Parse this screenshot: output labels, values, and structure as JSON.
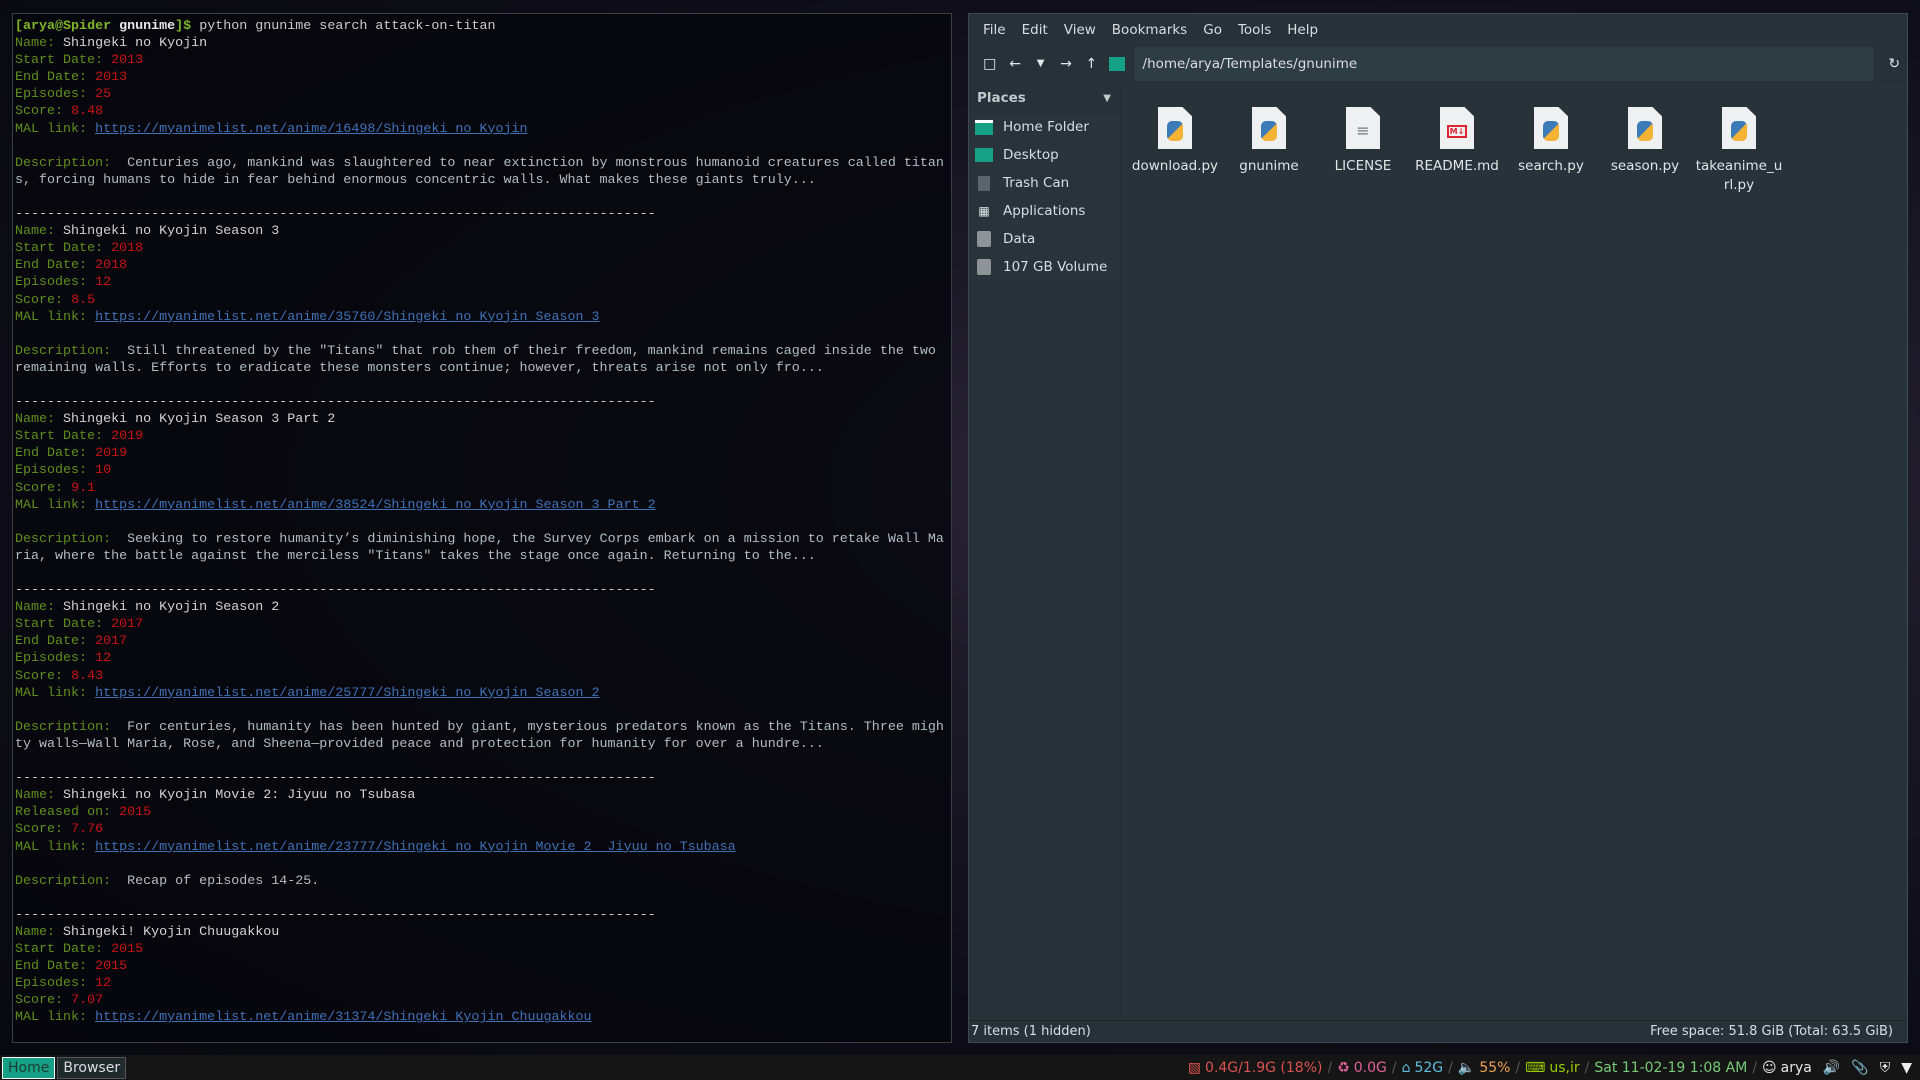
{
  "terminal": {
    "prompt": {
      "user_host": "[arya@Spider",
      "dir": "gnunime",
      "suffix": "]$",
      "command": " python gnunime search attack-on-titan"
    },
    "separator": "--------------------------------------------------------------------------------",
    "entries": [
      {
        "name_label": "Name: ",
        "name": "Shingeki no Kyojin",
        "fields": [
          {
            "label": "Start Date: ",
            "value": "2013"
          },
          {
            "label": "End Date: ",
            "value": "2013"
          },
          {
            "label": "Episodes: ",
            "value": "25"
          },
          {
            "label": "Score: ",
            "value": "8.48"
          }
        ],
        "link_label": "MAL link: ",
        "link": "https://myanimelist.net/anime/16498/Shingeki_no_Kyojin",
        "desc_label": "Description:  ",
        "description": "Centuries ago, mankind was slaughtered to near extinction by monstrous humanoid creatures called titans, forcing humans to hide in fear behind enormous concentric walls. What makes these giants truly..."
      },
      {
        "name_label": "Name: ",
        "name": "Shingeki no Kyojin Season 3",
        "fields": [
          {
            "label": "Start Date: ",
            "value": "2018"
          },
          {
            "label": "End Date: ",
            "value": "2018"
          },
          {
            "label": "Episodes: ",
            "value": "12"
          },
          {
            "label": "Score: ",
            "value": "8.5"
          }
        ],
        "link_label": "MAL link: ",
        "link": "https://myanimelist.net/anime/35760/Shingeki_no_Kyojin_Season_3",
        "desc_label": "Description:  ",
        "description": "Still threatened by the \"Titans\" that rob them of their freedom, mankind remains caged inside the two remaining walls. Efforts to eradicate these monsters continue; however, threats arise not only fro..."
      },
      {
        "name_label": "Name: ",
        "name": "Shingeki no Kyojin Season 3 Part 2",
        "fields": [
          {
            "label": "Start Date: ",
            "value": "2019"
          },
          {
            "label": "End Date: ",
            "value": "2019"
          },
          {
            "label": "Episodes: ",
            "value": "10"
          },
          {
            "label": "Score: ",
            "value": "9.1"
          }
        ],
        "link_label": "MAL link: ",
        "link": "https://myanimelist.net/anime/38524/Shingeki_no_Kyojin_Season_3_Part_2",
        "desc_label": "Description:  ",
        "description": "Seeking to restore humanity’s diminishing hope, the Survey Corps embark on a mission to retake Wall Maria, where the battle against the merciless \"Titans\" takes the stage once again. Returning to the..."
      },
      {
        "name_label": "Name: ",
        "name": "Shingeki no Kyojin Season 2",
        "fields": [
          {
            "label": "Start Date: ",
            "value": "2017"
          },
          {
            "label": "End Date: ",
            "value": "2017"
          },
          {
            "label": "Episodes: ",
            "value": "12"
          },
          {
            "label": "Score: ",
            "value": "8.43"
          }
        ],
        "link_label": "MAL link: ",
        "link": "https://myanimelist.net/anime/25777/Shingeki_no_Kyojin_Season_2",
        "desc_label": "Description:  ",
        "description": "For centuries, humanity has been hunted by giant, mysterious predators known as the Titans. Three mighty walls—Wall Maria, Rose, and Sheena—provided peace and protection for humanity for over a hundre..."
      },
      {
        "name_label": "Name: ",
        "name": "Shingeki no Kyojin Movie 2: Jiyuu no Tsubasa",
        "fields": [
          {
            "label": "Released on: ",
            "value": "2015"
          },
          {
            "label": "Score: ",
            "value": "7.76"
          }
        ],
        "link_label": "MAL link: ",
        "link": "https://myanimelist.net/anime/23777/Shingeki_no_Kyojin_Movie_2__Jiyuu_no_Tsubasa",
        "desc_label": "Description:  ",
        "description": "Recap of episodes 14-25."
      },
      {
        "name_label": "Name: ",
        "name": "Shingeki! Kyojin Chuugakkou",
        "fields": [
          {
            "label": "Start Date: ",
            "value": "2015"
          },
          {
            "label": "End Date: ",
            "value": "2015"
          },
          {
            "label": "Episodes: ",
            "value": "12"
          },
          {
            "label": "Score: ",
            "value": "7.07"
          }
        ],
        "link_label": "MAL link: ",
        "link": "https://myanimelist.net/anime/31374/Shingeki_Kyojin_Chuugakkou"
      }
    ]
  },
  "file_manager": {
    "menu": [
      "File",
      "Edit",
      "View",
      "Bookmarks",
      "Go",
      "Tools",
      "Help"
    ],
    "path": "/home/arya/Templates/gnunime",
    "places_title": "Places",
    "places": [
      {
        "label": "Home Folder",
        "icon": "home-folder-icon"
      },
      {
        "label": "Desktop",
        "icon": "desktop-icon"
      },
      {
        "label": "Trash Can",
        "icon": "trash-icon"
      },
      {
        "label": "Applications",
        "icon": "applications-icon"
      },
      {
        "label": "Data",
        "icon": "drive-icon"
      },
      {
        "label": "107 GB Volume",
        "icon": "drive-icon"
      }
    ],
    "files": [
      {
        "name": "download.py",
        "type": "python"
      },
      {
        "name": "gnunime",
        "type": "python"
      },
      {
        "name": "LICENSE",
        "type": "text"
      },
      {
        "name": "README.md",
        "type": "markdown"
      },
      {
        "name": "search.py",
        "type": "python"
      },
      {
        "name": "season.py",
        "type": "python"
      },
      {
        "name": "takeanime_url.py",
        "type": "python"
      }
    ],
    "status_left": "7 items (1 hidden)",
    "status_right": "Free space: 51.8 GiB (Total: 63.5 GiB)"
  },
  "taskbar": {
    "tasks": [
      {
        "label": "Home",
        "active": true
      },
      {
        "label": "Browser",
        "active": false
      }
    ],
    "tray": [
      {
        "icon": "memory-icon",
        "text": "0.4G/1.9G (18%)",
        "color": "#d9534f"
      },
      {
        "icon": "recycle-icon",
        "text": "0.0G",
        "color": "#e0609a"
      },
      {
        "icon": "home-icon",
        "text": "52G",
        "color": "#5bc0de"
      },
      {
        "icon": "volume-icon",
        "text": "55%",
        "color": "#f0a050"
      },
      {
        "icon": "keyboard-icon",
        "text": "us,ir",
        "color": "#99cc00"
      },
      {
        "icon": "",
        "text": "Sat 11-02-19  1:08 AM",
        "color": "#77cc77"
      },
      {
        "icon": "user-icon",
        "text": "arya",
        "color": "#e8e8e8"
      }
    ],
    "accent": "#16a085"
  }
}
